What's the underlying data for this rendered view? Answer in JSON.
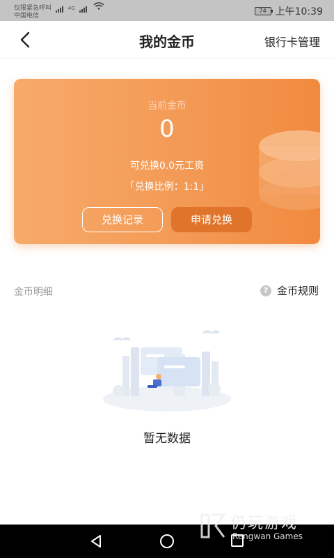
{
  "status_bar": {
    "carrier_line1": "仅限紧急呼叫",
    "carrier_line2": "中国电信",
    "network": "4G",
    "battery": "74",
    "time": "上午10:39"
  },
  "nav": {
    "title": "我的金币",
    "right_action": "银行卡管理"
  },
  "coin_card": {
    "label": "当前金币",
    "value": "0",
    "convertible": "可兑换0.0元工资",
    "ratio": "「兑换比例：1:1」",
    "history_button": "兑换记录",
    "apply_button": "申请兑换"
  },
  "details": {
    "label": "金币明细",
    "rules_label": "金币规则",
    "help_icon_glyph": "?",
    "empty_text": "暂无数据"
  },
  "watermark": {
    "title": "仍玩游戏",
    "subtitle": "Rengwan Games"
  },
  "colors": {
    "card_start": "#f7aa6b",
    "card_end": "#f18a3f",
    "apply_button": "#e0742a"
  }
}
